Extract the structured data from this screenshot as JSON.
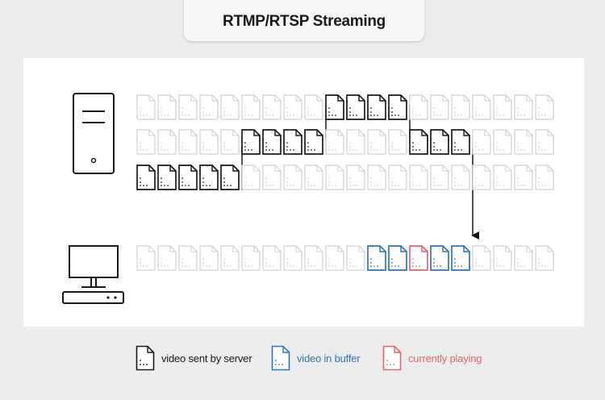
{
  "title": "RTMP/RTSP Streaming",
  "colors": {
    "sent": "#1a1a1a",
    "buffer": "#2f74c0",
    "playing": "#e8636b",
    "inactive": "#cfcfcf",
    "background": "#ececec",
    "panel": "#ffffff"
  },
  "icons": {
    "server": "server-tower-icon",
    "client": "desktop-computer-icon",
    "packet": "document-file-icon"
  },
  "rows": [
    {
      "name": "server-row-1",
      "count": 20,
      "sent": [
        9,
        10,
        11,
        12
      ]
    },
    {
      "name": "server-row-2",
      "count": 20,
      "sent": [
        5,
        6,
        7,
        8,
        13,
        14,
        15
      ]
    },
    {
      "name": "server-row-3",
      "count": 20,
      "sent": [
        0,
        1,
        2,
        3,
        4
      ]
    },
    {
      "name": "client-row",
      "count": 20,
      "buffer": [
        11,
        12,
        14,
        15
      ],
      "playing": [
        13
      ]
    }
  ],
  "legend": [
    {
      "type": "sent",
      "label": "video sent by server"
    },
    {
      "type": "buffer",
      "label": "video in buffer"
    },
    {
      "type": "playing",
      "label": "currently playing"
    }
  ]
}
